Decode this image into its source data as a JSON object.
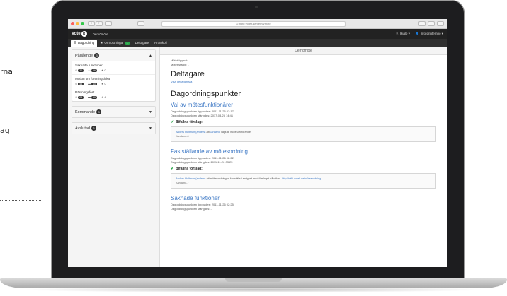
{
  "outside": {
    "fragment1": "rna",
    "fragment2": "ag"
  },
  "browser": {
    "url": "å mote.votelt.se/demo/mote",
    "back_glyph": "‹",
    "fwd_glyph": "›"
  },
  "app": {
    "logo": "Vote",
    "logo_mark": "it",
    "name": "Demömöte",
    "help": "ⓘ Hjälp ▾",
    "user": "👤 info-printempo ▾"
  },
  "tabs": [
    {
      "label": "Dagordning",
      "active": true
    },
    {
      "label": "Omröstningar",
      "badge": "1"
    },
    {
      "label": "Deltagare"
    },
    {
      "label": "Protokoll"
    }
  ],
  "sidebar": {
    "ongoing": {
      "title": "Pågående",
      "count": "3",
      "items": [
        {
          "name": "Saknade funktioner",
          "a": "20",
          "b": "66",
          "c": "0"
        },
        {
          "name": "Motion om föreningslokal",
          "a": "44",
          "b": "40",
          "c": "0"
        },
        {
          "name": "Rästningsfest",
          "a": "28",
          "b": "50",
          "c": "4"
        }
      ]
    },
    "upcoming": {
      "title": "Kommande",
      "count": "3"
    },
    "finished": {
      "title": "Avslutad",
      "count": "6"
    }
  },
  "main": {
    "header": "Demömöte",
    "meeting_opened": "Mötet öppnat: -",
    "meeting_closed": "Mötet stängt: -",
    "participants_title": "Deltagare",
    "participants_link": "Visa deltagarlista",
    "agenda_title": "Dagordningspunkter",
    "items": [
      {
        "title": "Val av mötesfunktionärer",
        "opened": "Dagordningspunkten öppnades: 2011-11-26 02:17",
        "closed": "Dagordningspunkten stängdes: 2017-08-25 14:41",
        "approved_label": "Bifallna förslag:",
        "proposal_author": "Anders Hultman (anders)",
        "proposal_mid": " att",
        "proposal_person": "Kandano",
        "proposal_text": " väljs till mötesordförande",
        "proposal_id": "Kandano-0"
      },
      {
        "title": "Fastställande av mötesordning",
        "opened": "Dagordningspunkten öppnades: 2011-11-26 02:22",
        "closed": "Dagordningspunkten stängdes: 2011-11-26 03:25",
        "approved_label": "Bifallna förslag:",
        "proposal_author": "Anders Hultman (anders)",
        "proposal_text": " att mötesordningen fastställs i enlighet med förslaget på wikin - ",
        "proposal_url": "http://wiki.votelt.se/mötesordning",
        "proposal_id": "Kandano-7"
      },
      {
        "title": "Saknade funktioner",
        "opened": "Dagordningspunkten öppnades: 2011-11-26 02:25",
        "closed": "Dagordningspunkten stängdes: -"
      }
    ]
  }
}
